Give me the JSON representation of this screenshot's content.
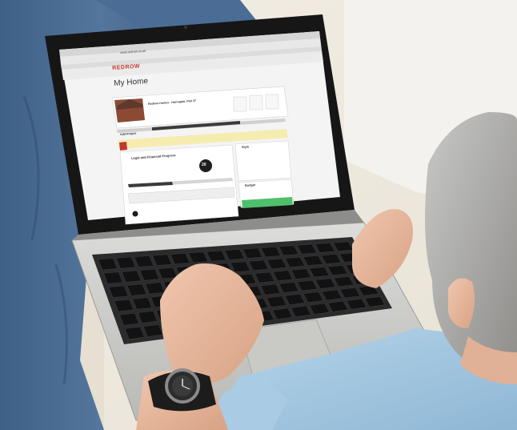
{
  "photo": {
    "browser": {
      "url": "www.redrow.co.uk"
    },
    "website": {
      "brand": "REDROW",
      "page_title": "My Home",
      "development": {
        "name": "Redrow Homes - Harrogate, Plot 37"
      },
      "stepper": {
        "current": "20"
      },
      "buttons": {
        "add_progress": "Add Project"
      },
      "cards": {
        "style": "Style",
        "budget": "Budget",
        "legal": "Legal and Financial Progress"
      }
    },
    "colors": {
      "brand_red": "#c0392b",
      "success_green": "#4fbf6b",
      "alert_yellow": "#f7ecb0"
    }
  }
}
